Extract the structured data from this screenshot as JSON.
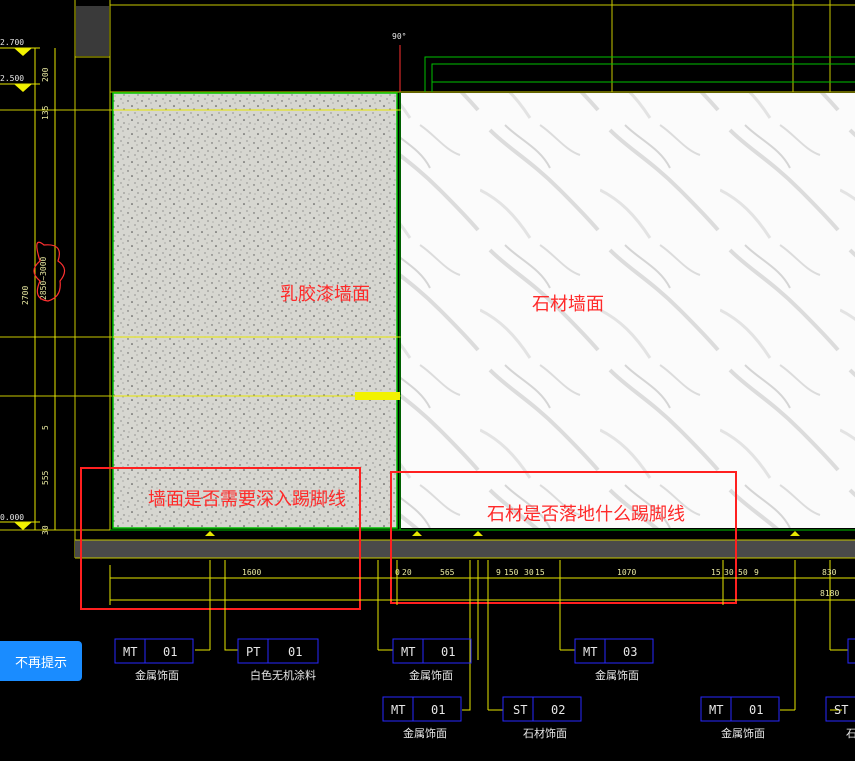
{
  "labels": {
    "latex_wall": "乳胶漆墙面",
    "stone_wall": "石材墙面",
    "q_skirting_wall": "墙面是否需要深入踢脚线",
    "q_skirting_stone": "石材是否落地什么踢脚线"
  },
  "levels": {
    "top": "2.700",
    "second": "2.500",
    "floor": "0.000",
    "angle": "90°"
  },
  "vertical_dims": [
    "200",
    "135",
    "2700",
    "2850~3000",
    "5",
    "555",
    "30"
  ],
  "bottom_dims": [
    "1600",
    "0",
    "20",
    "565",
    "9",
    "150",
    "30",
    "15",
    "1070",
    "15",
    "30",
    "50",
    "9",
    "830",
    "8180"
  ],
  "material_tags": [
    {
      "code": "MT",
      "num": "01",
      "desc": "金属饰面"
    },
    {
      "code": "PT",
      "num": "01",
      "desc": "白色无机涂料"
    },
    {
      "code": "MT",
      "num": "01",
      "desc": "金属饰面"
    },
    {
      "code": "MT",
      "num": "03",
      "desc": "金属饰面"
    },
    {
      "code": "MT",
      "num": "01",
      "desc": "金属饰面"
    },
    {
      "code": "ST",
      "num": "02",
      "desc": "石材饰面"
    },
    {
      "code": "MT",
      "num": "01",
      "desc": "金属饰面"
    },
    {
      "code": "ST",
      "num": "",
      "desc": "石"
    }
  ],
  "button": {
    "dismiss": "不再提示"
  },
  "colors": {
    "background": "#000000",
    "cad_yellow": "#e6e600",
    "cad_green": "#00c000",
    "tag_blue": "#2828ff",
    "annotation_red": "#ff2020",
    "button_blue": "#1a8cff"
  }
}
